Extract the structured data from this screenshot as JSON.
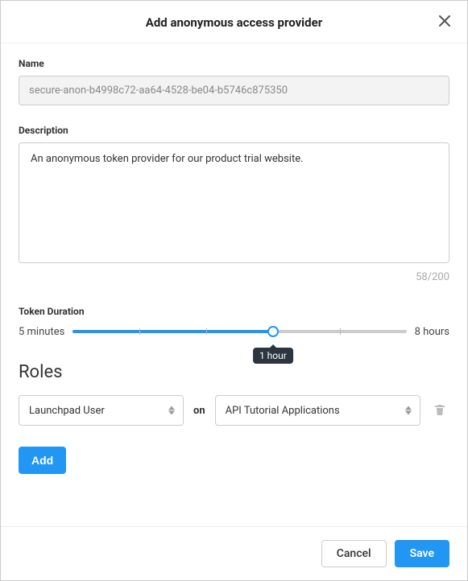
{
  "header": {
    "title": "Add anonymous access provider"
  },
  "name": {
    "label": "Name",
    "value": "secure-anon-b4998c72-aa64-4528-be04-b5746c875350"
  },
  "description": {
    "label": "Description",
    "value": "An anonymous token provider for our product trial website.",
    "count": "58/200"
  },
  "duration": {
    "label": "Token Duration",
    "min_label": "5 minutes",
    "max_label": "8 hours",
    "value_label": "1 hour",
    "percent": 60
  },
  "roles": {
    "heading": "Roles",
    "on_label": "on",
    "items": [
      {
        "role": "Launchpad User",
        "app": "API Tutorial Applications"
      }
    ],
    "add_label": "Add"
  },
  "footer": {
    "cancel": "Cancel",
    "save": "Save"
  }
}
